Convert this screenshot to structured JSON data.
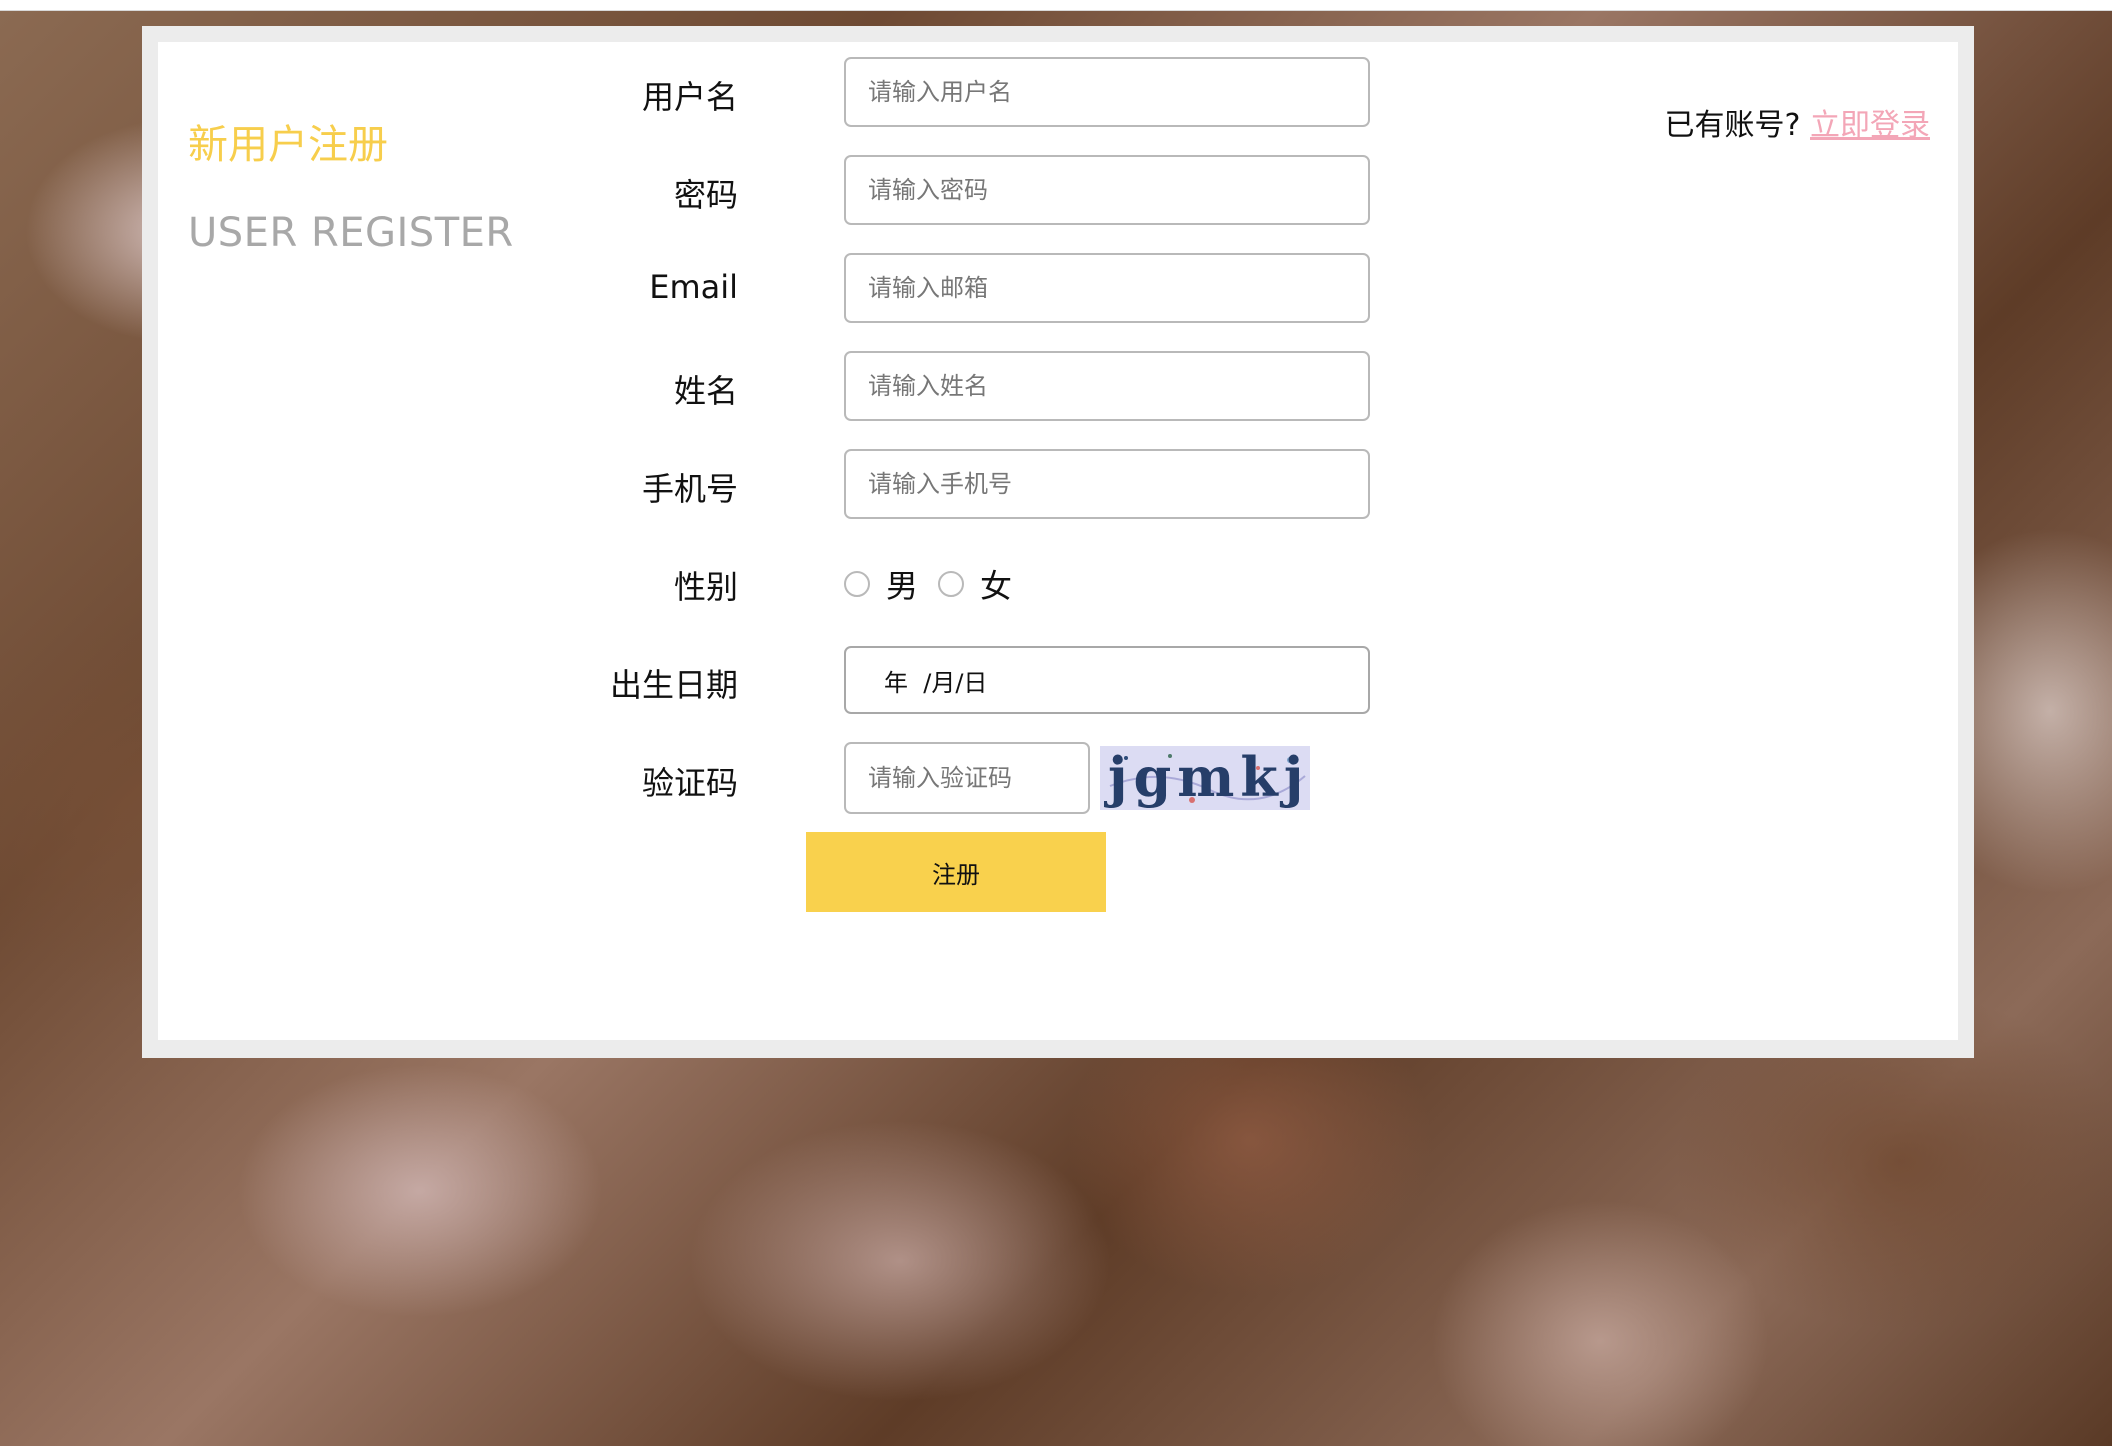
{
  "header": {
    "title_cn": "新用户注册",
    "title_en": "USER REGISTER"
  },
  "login": {
    "prompt": "已有账号?",
    "link": "立即登录"
  },
  "form": {
    "username": {
      "label": "用户名",
      "placeholder": "请输入用户名"
    },
    "password": {
      "label": "密码",
      "placeholder": "请输入密码"
    },
    "email": {
      "label": "Email",
      "placeholder": "请输入邮箱"
    },
    "name": {
      "label": "姓名",
      "placeholder": "请输入姓名"
    },
    "phone": {
      "label": "手机号",
      "placeholder": "请输入手机号"
    },
    "gender": {
      "label": "性别",
      "options": [
        "男",
        "女"
      ]
    },
    "birthday": {
      "label": "出生日期",
      "value": "年  /月/日"
    },
    "captcha": {
      "label": "验证码",
      "placeholder": "请输入验证码",
      "code": "jgmkj"
    },
    "submit_label": "注册"
  },
  "colors": {
    "accent": "#f9d14d",
    "title_cn": "#f7ce4c",
    "title_en": "#a8a8a8",
    "login_link": "#f3a6b7"
  }
}
